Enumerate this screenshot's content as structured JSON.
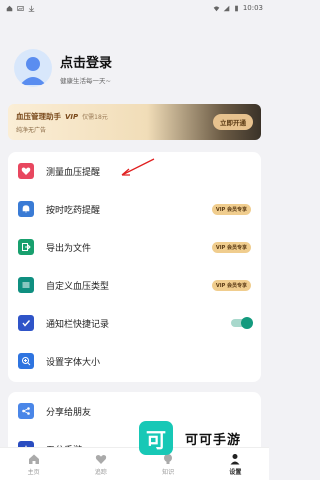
{
  "status_bar": {
    "time": "10:03"
  },
  "profile": {
    "title": "点击登录",
    "subtitle": "健康生活每一天~"
  },
  "vip_banner": {
    "title": "血压管理助手",
    "tag": "VIP",
    "price": "仅需18元",
    "subtitle": "纯净无广告",
    "button": "立即开通"
  },
  "menu": [
    {
      "label": "测量血压提醒",
      "icon": "heart-icon",
      "color": "#e8475f"
    },
    {
      "label": "按时吃药提醒",
      "icon": "bell-icon",
      "color": "#3a7bd5",
      "badge": "VIP 会员专享"
    },
    {
      "label": "导出为文件",
      "icon": "export-icon",
      "color": "#18a06e",
      "badge": "VIP 会员专享"
    },
    {
      "label": "自定义血压类型",
      "icon": "sliders-icon",
      "color": "#0f8f80",
      "badge": "VIP 会员专享"
    },
    {
      "label": "通知栏快捷记录",
      "icon": "checkbox-icon",
      "color": "#2f54c8",
      "toggle": true
    },
    {
      "label": "设置字体大小",
      "icon": "zoom-icon",
      "color": "#2e74e0"
    }
  ],
  "menu2": [
    {
      "label": "分享给朋友",
      "icon": "share-icon",
      "color": "#4a86e8"
    },
    {
      "label": "五分手游",
      "icon": "star-icon",
      "color": "#2a4cc0"
    }
  ],
  "bottom_nav": [
    {
      "label": "主页",
      "icon": "home-icon"
    },
    {
      "label": "追踪",
      "icon": "heart-icon"
    },
    {
      "label": "知识",
      "icon": "bulb-icon"
    },
    {
      "label": "设置",
      "icon": "person-icon"
    }
  ],
  "watermark": {
    "logo": "可",
    "text": "可可手游"
  }
}
